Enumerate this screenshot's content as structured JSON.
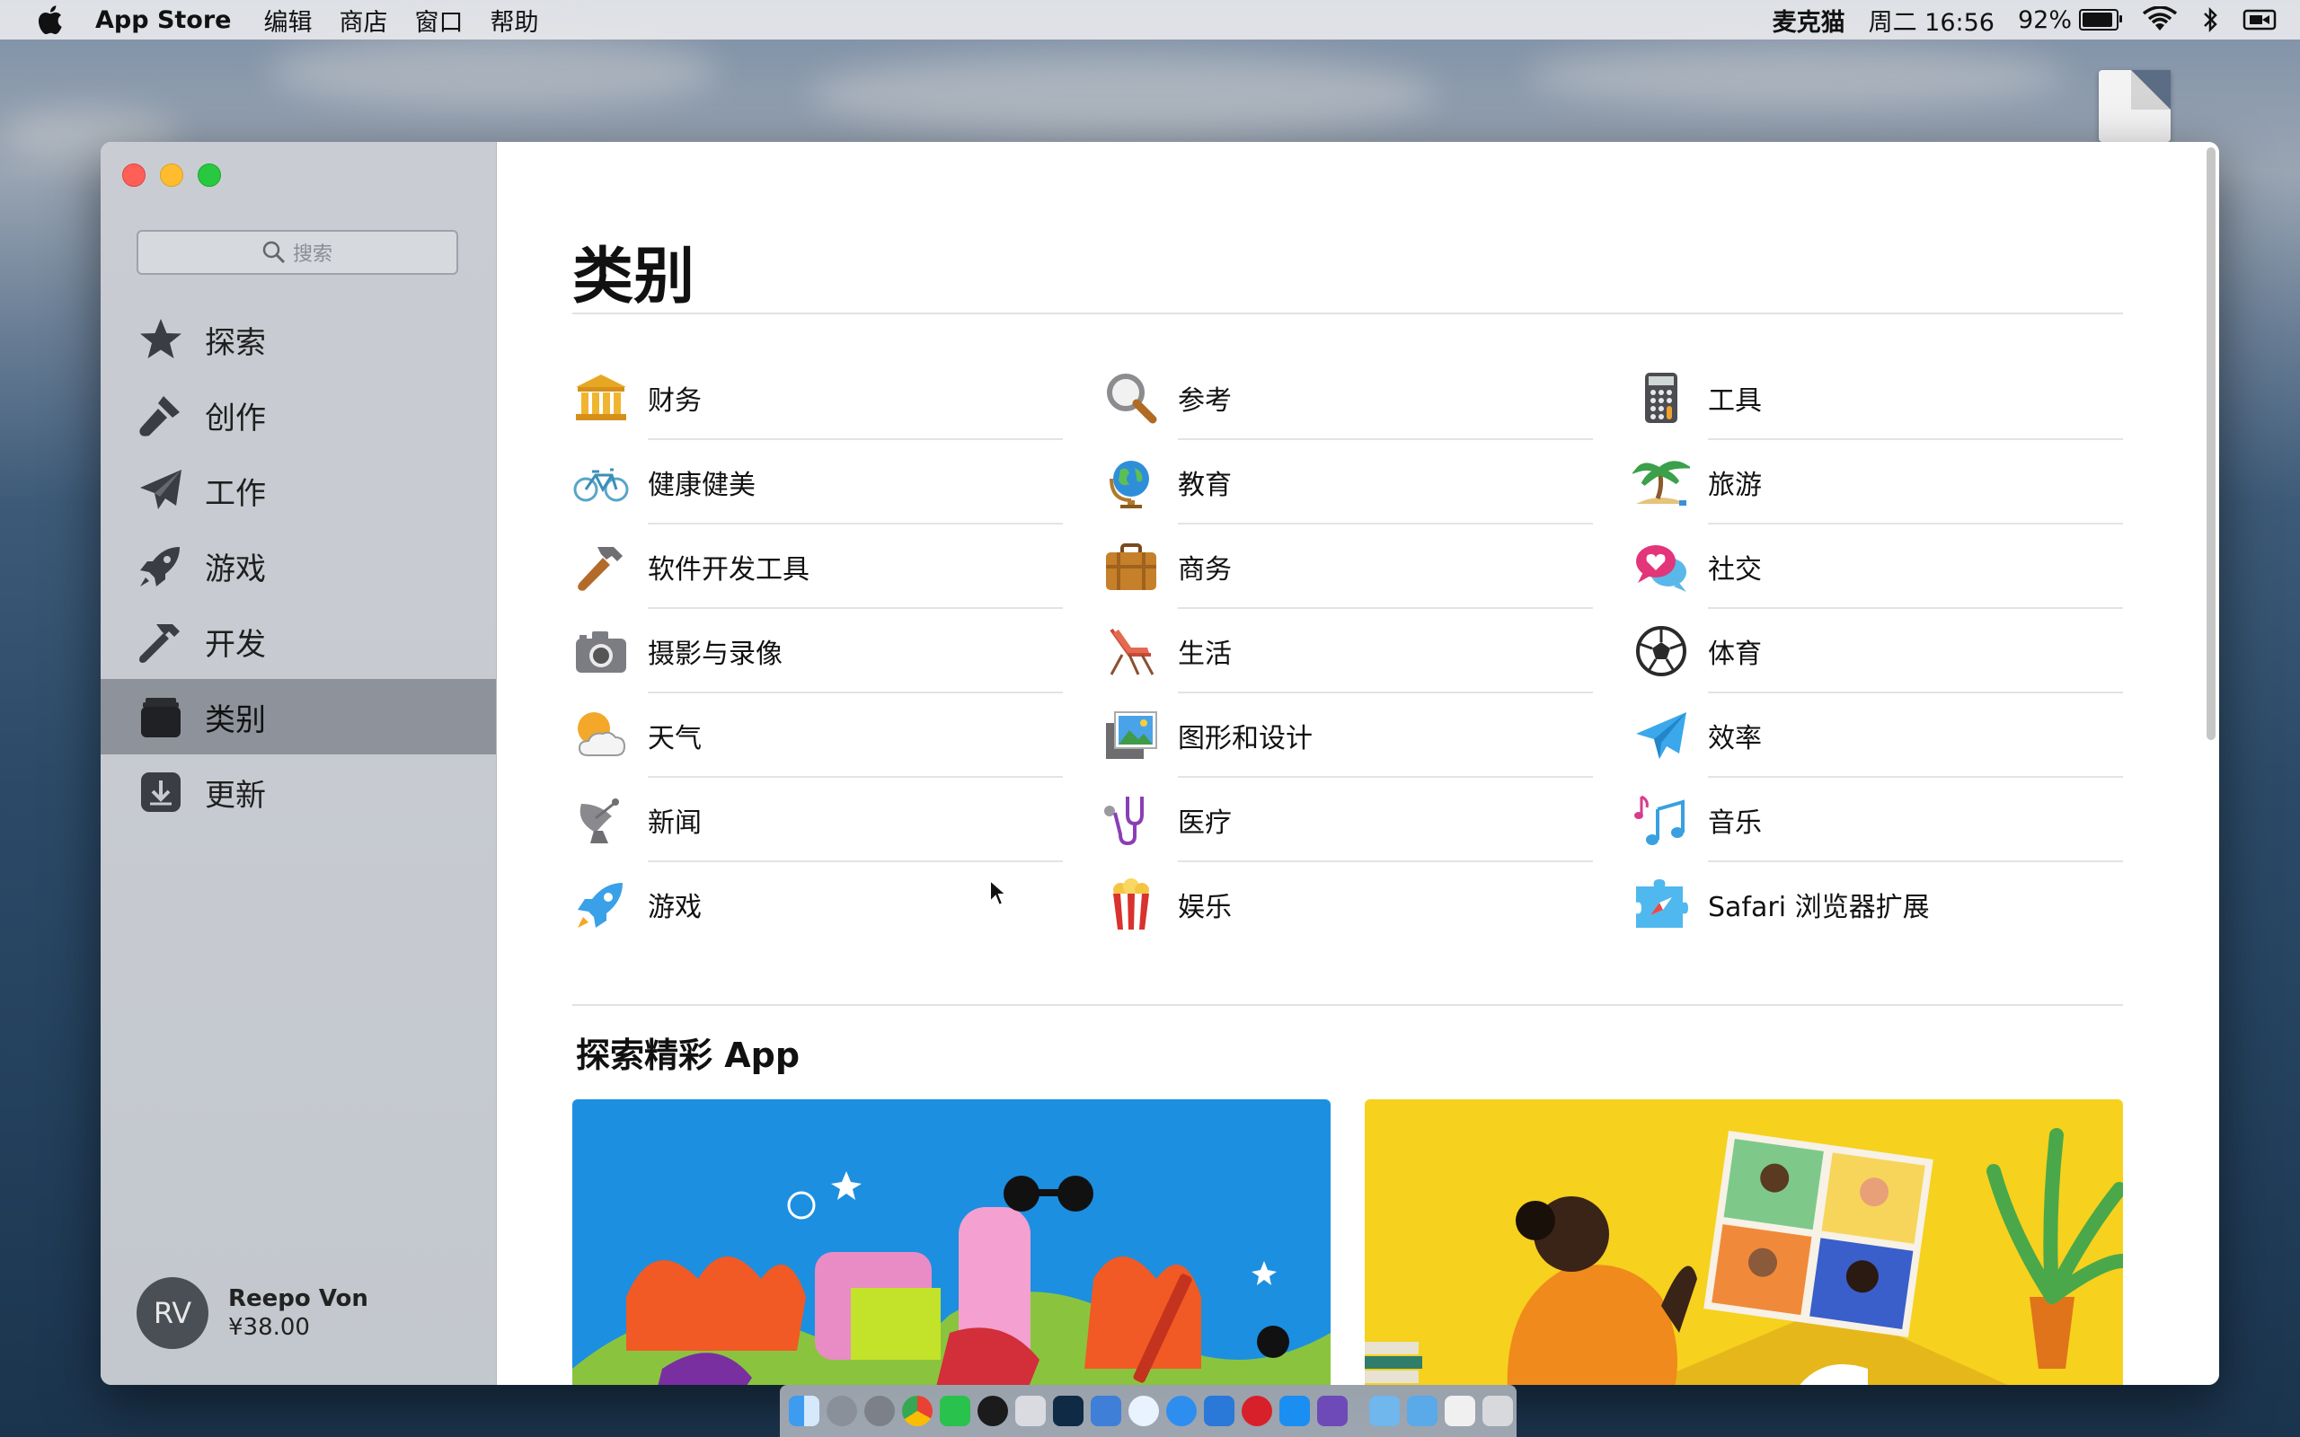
{
  "menubar": {
    "app_name": "App Store",
    "menus": [
      "编辑",
      "商店",
      "窗口",
      "帮助"
    ],
    "user": "麦克猫",
    "datetime": "周二 16:56",
    "battery_percent": "92%",
    "battery_level": 0.92
  },
  "sidebar": {
    "search_placeholder": "搜索",
    "items": [
      {
        "label": "探索",
        "icon": "star-icon"
      },
      {
        "label": "创作",
        "icon": "brush-icon"
      },
      {
        "label": "工作",
        "icon": "paper-plane-icon"
      },
      {
        "label": "游戏",
        "icon": "rocket-icon"
      },
      {
        "label": "开发",
        "icon": "hammer-icon"
      },
      {
        "label": "类别",
        "icon": "stack-icon",
        "active": true
      },
      {
        "label": "更新",
        "icon": "download-icon"
      }
    ],
    "user": {
      "initials": "RV",
      "name": "Reepo Von",
      "balance": "¥38.00"
    }
  },
  "main": {
    "title": "类别",
    "categories": [
      [
        {
          "label": "财务",
          "icon": "bank-icon"
        },
        {
          "label": "健康健美",
          "icon": "bicycle-icon"
        },
        {
          "label": "软件开发工具",
          "icon": "hammer-icon"
        },
        {
          "label": "摄影与录像",
          "icon": "camera-icon"
        },
        {
          "label": "天气",
          "icon": "weather-icon"
        },
        {
          "label": "新闻",
          "icon": "satellite-dish-icon"
        },
        {
          "label": "游戏",
          "icon": "rocket-icon"
        }
      ],
      [
        {
          "label": "参考",
          "icon": "magnifier-icon"
        },
        {
          "label": "教育",
          "icon": "globe-icon"
        },
        {
          "label": "商务",
          "icon": "briefcase-icon"
        },
        {
          "label": "生活",
          "icon": "beach-chair-icon"
        },
        {
          "label": "图形和设计",
          "icon": "photos-icon"
        },
        {
          "label": "医疗",
          "icon": "stethoscope-icon"
        },
        {
          "label": "娱乐",
          "icon": "popcorn-icon"
        }
      ],
      [
        {
          "label": "工具",
          "icon": "calculator-icon"
        },
        {
          "label": "旅游",
          "icon": "palm-tree-icon"
        },
        {
          "label": "社交",
          "icon": "chat-heart-icon"
        },
        {
          "label": "体育",
          "icon": "soccer-ball-icon"
        },
        {
          "label": "效率",
          "icon": "paper-plane-icon"
        },
        {
          "label": "音乐",
          "icon": "music-notes-icon"
        },
        {
          "label": "Safari 浏览器扩展",
          "icon": "puzzle-compass-icon"
        }
      ]
    ],
    "section_title": "探索精彩 App"
  },
  "colors": {
    "accent_blue": "#1c8fe0",
    "card_yellow": "#f6d11e",
    "sidebar_active": "#8e939b"
  }
}
